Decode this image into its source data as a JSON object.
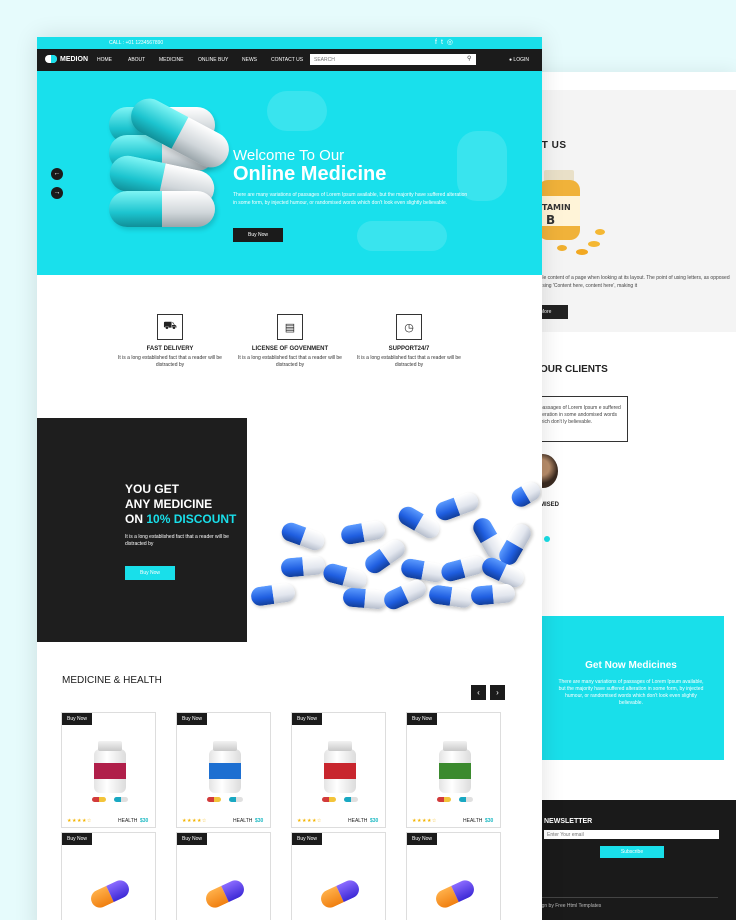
{
  "topbar": {
    "call": "CALL : +01 1234567890",
    "social_icons": [
      "facebook-icon",
      "twitter-icon",
      "instagram-icon"
    ]
  },
  "nav": {
    "logo": "MEDION",
    "items": [
      "HOME",
      "ABOUT",
      "MEDICINE",
      "ONLINE BUY",
      "NEWS",
      "CONTACT US"
    ],
    "search_placeholder": "SEARCH",
    "login": "LOGIN"
  },
  "hero": {
    "title1": "Welcome To Our",
    "title2": "Online Medicine",
    "text": "There are many variations of passages of Lorem Ipsum available, but the majority have suffered alteration in some form, by injected humour, or randomised words which don't look even slightly believable.",
    "button": "Buy Now"
  },
  "features": [
    {
      "icon": "truck-icon",
      "title": "FAST DELIVERY",
      "text": "It is a long established fact that a reader will be distracted by"
    },
    {
      "icon": "license-icon",
      "title": "LICENSE OF GOVENMENT",
      "text": "It is a long established fact that a reader will be distracted by"
    },
    {
      "icon": "clock-24-icon",
      "title": "SUPPORT24/7",
      "text": "It is a long established fact that a reader will be distracted by"
    }
  ],
  "promo": {
    "line1": "YOU GET",
    "line2": "ANY MEDICINE",
    "line3_prefix": "ON ",
    "line3_highlight": "10% DISCOUNT",
    "text": "It is a long established fact that a reader will be distracted by",
    "button": "Buy Now"
  },
  "products": {
    "title": "MEDICINE & HEALTH",
    "buy_label": "Buy Now",
    "cards": [
      {
        "category": "HEALTH",
        "price": "$30",
        "label_color": "#b01f4a"
      },
      {
        "category": "HEALTH",
        "price": "$30",
        "label_color": "#1d6fd1"
      },
      {
        "category": "HEALTH",
        "price": "$30",
        "label_color": "#c8262e"
      },
      {
        "category": "HEALTH",
        "price": "$30",
        "label_color": "#3b8a2e"
      },
      {
        "category": "",
        "price": ""
      },
      {
        "category": "",
        "price": ""
      },
      {
        "category": "",
        "price": ""
      },
      {
        "category": "",
        "price": ""
      }
    ],
    "rating_stars": "★★★★☆"
  },
  "back": {
    "about_title": "UT US",
    "about_text": "dable content of a page when looking at its layout. The point of using letters, as opposed to using 'Content here, content here', making it",
    "about_btn": "More",
    "clients_title": "OUR CLIENTS",
    "quote": "f passages of Lorem Ipsum e suffered alteration in some andomised words which don't ly believable.",
    "client_name": "MISED",
    "getnow_title": "Get Now Medicines",
    "getnow_text": "There are many variations of passages of Lorem Ipsum available, but the majority have suffered alteration in some form, by injected humour, or randomised words which don't look even slightly believable.",
    "newsletter_title": "NEWSLETTER",
    "newsletter_placeholder": "Enter Your email",
    "newsletter_btn": "Subscribe",
    "credit": "sign by Free Html Templates"
  },
  "colors": {
    "accent": "#19dfea",
    "dark": "#1b1b1b"
  }
}
